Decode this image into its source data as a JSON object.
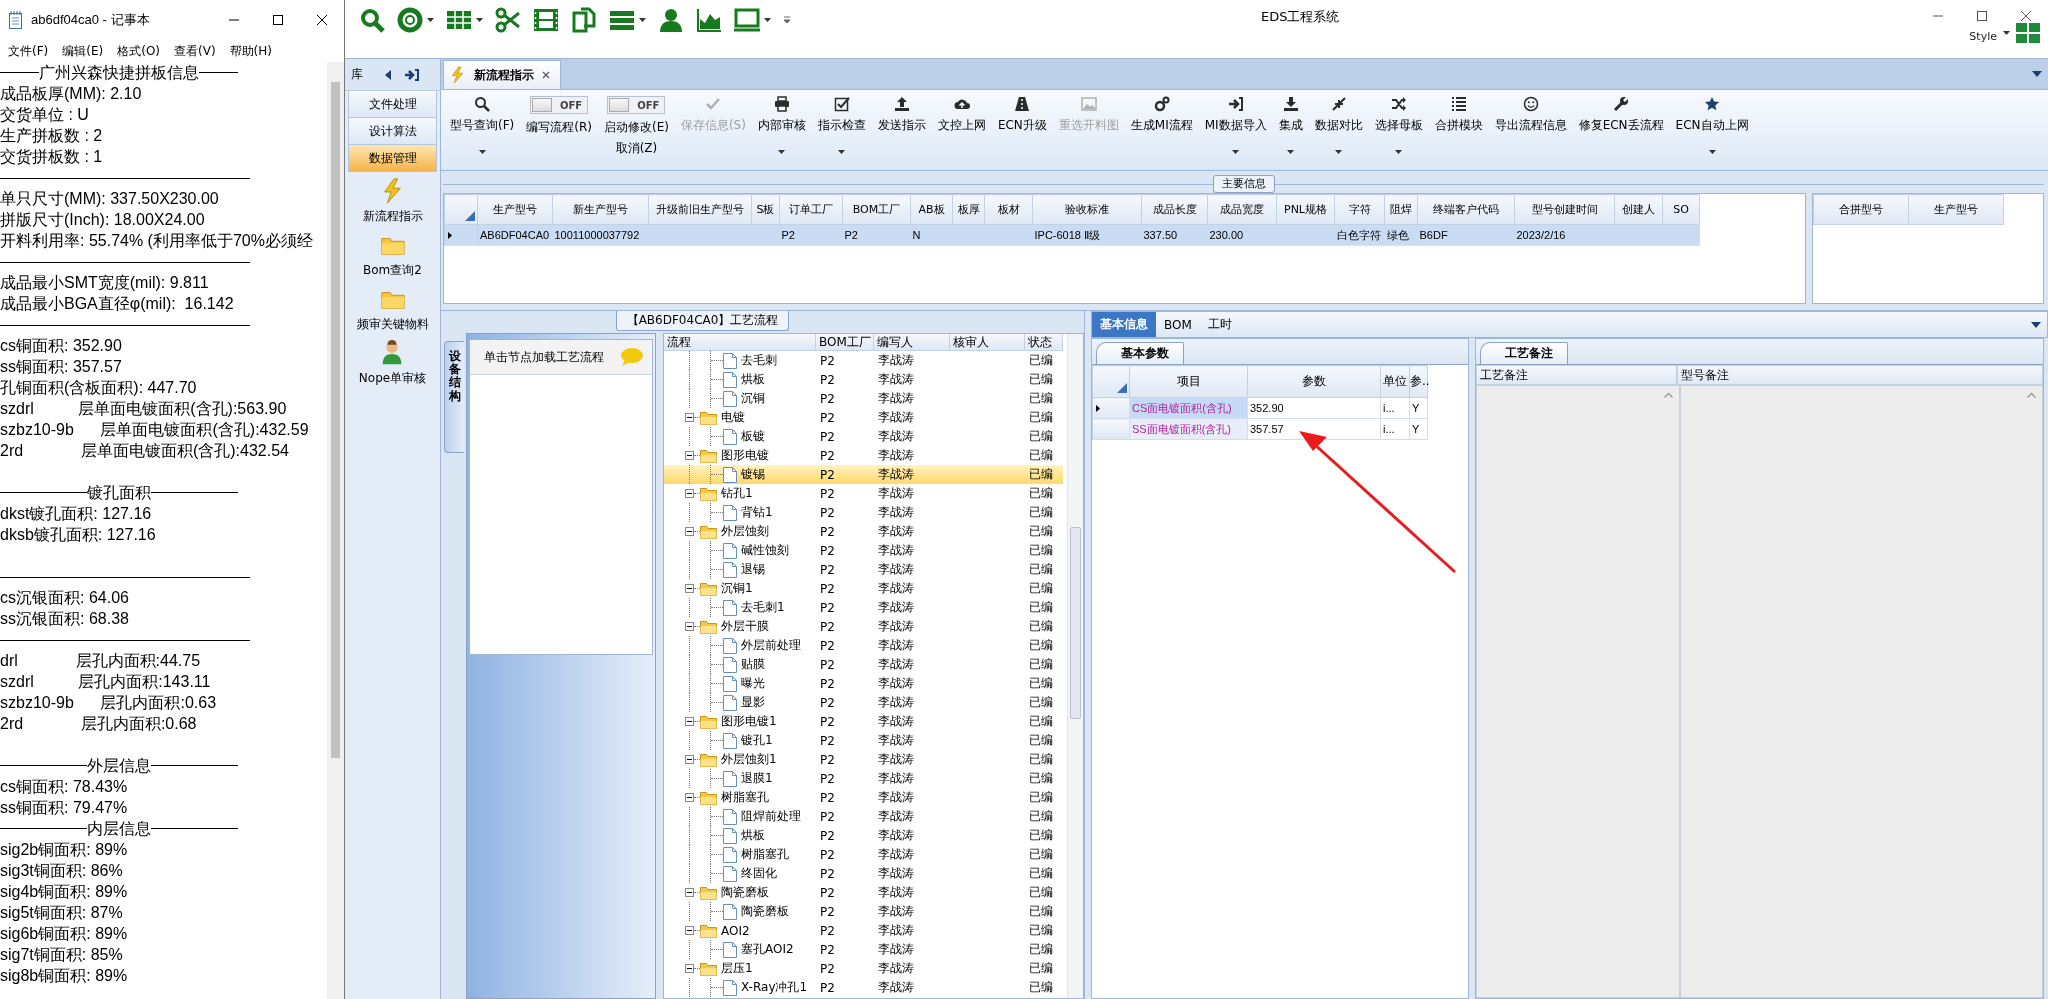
{
  "notepad": {
    "title": "ab6df04ca0 - 记事本",
    "menu": [
      "文件(F)",
      "编辑(E)",
      "格式(O)",
      "查看(V)",
      "帮助(H)"
    ],
    "lines": [
      {
        "kind": "heading",
        "text": "广州兴森快捷拼板信息"
      },
      {
        "kind": "text",
        "text": "成品板厚(MM): 2.10"
      },
      {
        "kind": "text",
        "text": "交货单位 : U"
      },
      {
        "kind": "text",
        "text": "生产拼板数 : 2"
      },
      {
        "kind": "text",
        "text": "交货拼板数 : 1"
      },
      {
        "kind": "rule"
      },
      {
        "kind": "text",
        "text": "单只尺寸(MM): 337.50X230.00"
      },
      {
        "kind": "text",
        "text": "拼版尺寸(Inch): 18.00X24.00"
      },
      {
        "kind": "text",
        "text": "开料利用率: 55.74% (利用率低于70%必须经"
      },
      {
        "kind": "rule"
      },
      {
        "kind": "text",
        "text": "成品最小SMT宽度(mil): 9.811"
      },
      {
        "kind": "text",
        "text": "成品最小BGA直径φ(mil):  16.142"
      },
      {
        "kind": "rule"
      },
      {
        "kind": "text",
        "text": "cs铜面积: 352.90"
      },
      {
        "kind": "text",
        "text": "ss铜面积: 357.57"
      },
      {
        "kind": "text",
        "text": "孔铜面积(含板面积): 447.70"
      },
      {
        "kind": "text",
        "text": "szdrl          层单面电镀面积(含孔):563.90"
      },
      {
        "kind": "text",
        "text": "szbz10-9b      层单面电镀面积(含孔):432.59"
      },
      {
        "kind": "text",
        "text": "2rd             层单面电镀面积(含孔):432.54"
      },
      {
        "kind": "blank"
      },
      {
        "kind": "heading",
        "text": "镀孔面积"
      },
      {
        "kind": "text",
        "text": "dkst镀孔面积: 127.16"
      },
      {
        "kind": "text",
        "text": "dksb镀孔面积: 127.16"
      },
      {
        "kind": "blank"
      },
      {
        "kind": "rule"
      },
      {
        "kind": "text",
        "text": "cs沉银面积: 64.06"
      },
      {
        "kind": "text",
        "text": "ss沉银面积: 68.38"
      },
      {
        "kind": "rule"
      },
      {
        "kind": "text",
        "text": "drl             层孔内面积:44.75"
      },
      {
        "kind": "text",
        "text": "szdrl          层孔内面积:143.11"
      },
      {
        "kind": "text",
        "text": "szbz10-9b      层孔内面积:0.63"
      },
      {
        "kind": "text",
        "text": "2rd             层孔内面积:0.68"
      },
      {
        "kind": "blank"
      },
      {
        "kind": "heading",
        "text": "外层信息"
      },
      {
        "kind": "text",
        "text": "cs铜面积: 78.43%"
      },
      {
        "kind": "text",
        "text": "ss铜面积: 79.47%"
      },
      {
        "kind": "heading",
        "text": "内层信息"
      },
      {
        "kind": "text",
        "text": "sig2b铜面积: 89%"
      },
      {
        "kind": "text",
        "text": "sig3t铜面积: 86%"
      },
      {
        "kind": "text",
        "text": "sig4b铜面积: 89%"
      },
      {
        "kind": "text",
        "text": "sig5t铜面积: 87%"
      },
      {
        "kind": "text",
        "text": "sig6b铜面积: 89%"
      },
      {
        "kind": "text",
        "text": "sig7t铜面积: 85%"
      },
      {
        "kind": "text",
        "text": "sig8b铜面积: 89%"
      }
    ]
  },
  "app": {
    "title": "EDS工程系统",
    "style_menu": "Style",
    "sidebar": {
      "header": "库",
      "items": [
        {
          "label": "文件处理",
          "selected": false
        },
        {
          "label": "设计算法",
          "selected": false
        },
        {
          "label": "数据管理",
          "selected": true
        }
      ],
      "shortcuts": [
        {
          "label": "新流程指示"
        },
        {
          "label": "Bom查询2"
        },
        {
          "label": "频审关键物料"
        },
        {
          "label": "Nope单审核"
        }
      ]
    },
    "tabs": [
      {
        "label": "新流程指示",
        "selected": true
      }
    ],
    "ribbon": [
      {
        "kind": "button",
        "label": "型号查询(F)",
        "disabled": false,
        "menu": true
      },
      {
        "kind": "toggle",
        "label": "编写流程(R)",
        "state_text": "OFF",
        "on": false
      },
      {
        "kind": "toggle",
        "label": "启动修改(E)",
        "label2": "取消(Z)",
        "state_text": "OFF",
        "on": false
      },
      {
        "kind": "button",
        "label": "保存信息(S)",
        "disabled": true,
        "menu": false
      },
      {
        "kind": "button",
        "label": "内部审核",
        "disabled": false,
        "menu": true
      },
      {
        "kind": "button",
        "label": "指示检查",
        "disabled": false,
        "menu": true
      },
      {
        "kind": "button",
        "label": "发送指示",
        "disabled": false,
        "menu": false
      },
      {
        "kind": "button",
        "label": "文控上网",
        "disabled": false,
        "menu": false
      },
      {
        "kind": "button",
        "label": "ECN升级",
        "disabled": false,
        "menu": false
      },
      {
        "kind": "button",
        "label": "重选开料图",
        "disabled": true,
        "menu": false
      },
      {
        "kind": "button",
        "label": "生成MI流程",
        "disabled": false,
        "menu": false
      },
      {
        "kind": "button",
        "label": "MI数据导入",
        "disabled": false,
        "menu": true
      },
      {
        "kind": "button",
        "label": "集成",
        "disabled": false,
        "menu": true
      },
      {
        "kind": "button",
        "label": "数据对比",
        "disabled": false,
        "menu": true
      },
      {
        "kind": "button",
        "label": "选择母板",
        "disabled": false,
        "menu": true
      },
      {
        "kind": "button",
        "label": "合拼模块",
        "disabled": false,
        "menu": false
      },
      {
        "kind": "button",
        "label": "导出流程信息",
        "disabled": false,
        "menu": false
      },
      {
        "kind": "button",
        "label": "修复ECN丢流程",
        "disabled": false,
        "menu": false
      },
      {
        "kind": "button",
        "label": "ECN自动上网",
        "disabled": false,
        "menu": true
      }
    ],
    "main_info": {
      "title": "主要信息",
      "columns": [
        "生产型号",
        "新生产型号",
        "升级前旧生产型号",
        "S板",
        "订单工厂",
        "BOM工厂",
        "AB板",
        "板厚",
        "板材",
        "验收标准",
        "成品长度",
        "成品宽度",
        "PNL规格",
        "字符",
        "阻焊",
        "终端客户代码",
        "型号创建时间",
        "创建人",
        "SO"
      ],
      "rows": [
        {
          "selected": true,
          "cells": [
            "AB6DF04CA0",
            "10011000037792",
            null,
            null,
            "P2",
            "P2",
            "N",
            null,
            null,
            "IPC-6018 Ⅱ级",
            "337.50",
            "230.00",
            null,
            "白色字符",
            "绿色",
            "B6DF",
            "2023/2/16",
            null,
            null
          ]
        }
      ],
      "side_columns": [
        "合拼型号",
        "生产型号"
      ]
    },
    "process_flow": {
      "title": "【AB6DF04CA0】工艺流程",
      "side_tab": "设备结构",
      "hint": "单击节点加载工艺流程",
      "columns": [
        "流程",
        "BOM工厂",
        "编写人",
        "核审人",
        "状态"
      ],
      "tree": [
        {
          "children": [
            {
              "label": "去毛刺",
              "factory": "P2",
              "author": "李战涛",
              "status": "已编",
              "selected": false
            },
            {
              "label": "烘板",
              "factory": "P2",
              "author": "李战涛",
              "status": "已编",
              "selected": false
            },
            {
              "label": "沉铜",
              "factory": "P2",
              "author": "李战涛",
              "status": "已编",
              "selected": false
            }
          ]
        },
        {
          "label": "电镀",
          "factory": "P2",
          "author": "李战涛",
          "status": "已编",
          "selected": false,
          "expanded": true,
          "children": [
            {
              "label": "板镀",
              "factory": "P2",
              "author": "李战涛",
              "status": "已编",
              "selected": false
            }
          ]
        },
        {
          "label": "图形电镀",
          "factory": "P2",
          "author": "李战涛",
          "status": "已编",
          "selected": false,
          "expanded": true,
          "children": [
            {
              "label": "镀锡",
              "factory": "P2",
              "author": "李战涛",
              "status": "已编",
              "selected": true
            }
          ]
        },
        {
          "label": "钻孔1",
          "factory": "P2",
          "author": "李战涛",
          "status": "已编",
          "selected": false,
          "expanded": true,
          "children": [
            {
              "label": "背钻1",
              "factory": "P2",
              "author": "李战涛",
              "status": "已编",
              "selected": false
            }
          ]
        },
        {
          "label": "外层蚀刻",
          "factory": "P2",
          "author": "李战涛",
          "status": "已编",
          "selected": false,
          "expanded": true,
          "children": [
            {
              "label": "碱性蚀刻",
              "factory": "P2",
              "author": "李战涛",
              "status": "已编",
              "selected": false
            },
            {
              "label": "退锡",
              "factory": "P2",
              "author": "李战涛",
              "status": "已编",
              "selected": false
            }
          ]
        },
        {
          "label": "沉铜1",
          "factory": "P2",
          "author": "李战涛",
          "status": "已编",
          "selected": false,
          "expanded": true,
          "children": [
            {
              "label": "去毛刺1",
              "factory": "P2",
              "author": "李战涛",
              "status": "已编",
              "selected": false
            }
          ]
        },
        {
          "label": "外层干膜",
          "factory": "P2",
          "author": "李战涛",
          "status": "已编",
          "selected": false,
          "expanded": true,
          "children": [
            {
              "label": "外层前处理",
              "factory": "P2",
              "author": "李战涛",
              "status": "已编",
              "selected": false
            },
            {
              "label": "贴膜",
              "factory": "P2",
              "author": "李战涛",
              "status": "已编",
              "selected": false
            },
            {
              "label": "曝光",
              "factory": "P2",
              "author": "李战涛",
              "status": "已编",
              "selected": false
            },
            {
              "label": "显影",
              "factory": "P2",
              "author": "李战涛",
              "status": "已编",
              "selected": false
            }
          ]
        },
        {
          "label": "图形电镀1",
          "factory": "P2",
          "author": "李战涛",
          "status": "已编",
          "selected": false,
          "expanded": true,
          "children": [
            {
              "label": "镀孔1",
              "factory": "P2",
              "author": "李战涛",
              "status": "已编",
              "selected": false
            }
          ]
        },
        {
          "label": "外层蚀刻1",
          "factory": "P2",
          "author": "李战涛",
          "status": "已编",
          "selected": false,
          "expanded": true,
          "children": [
            {
              "label": "退膜1",
              "factory": "P2",
              "author": "李战涛",
              "status": "已编",
              "selected": false
            }
          ]
        },
        {
          "label": "树脂塞孔",
          "factory": "P2",
          "author": "李战涛",
          "status": "已编",
          "selected": false,
          "expanded": true,
          "children": [
            {
              "label": "阻焊前处理",
              "factory": "P2",
              "author": "李战涛",
              "status": "已编",
              "selected": false
            },
            {
              "label": "烘板",
              "factory": "P2",
              "author": "李战涛",
              "status": "已编",
              "selected": false
            },
            {
              "label": "树脂塞孔",
              "factory": "P2",
              "author": "李战涛",
              "status": "已编",
              "selected": false
            },
            {
              "label": "终固化",
              "factory": "P2",
              "author": "李战涛",
              "status": "已编",
              "selected": false
            }
          ]
        },
        {
          "label": "陶瓷磨板",
          "factory": "P2",
          "author": "李战涛",
          "status": "已编",
          "selected": false,
          "expanded": true,
          "children": [
            {
              "label": "陶瓷磨板",
              "factory": "P2",
              "author": "李战涛",
              "status": "已编",
              "selected": false
            }
          ]
        },
        {
          "label": "AOI2",
          "factory": "P2",
          "author": "李战涛",
          "status": "已编",
          "selected": false,
          "expanded": true,
          "children": [
            {
              "label": "塞孔AOI2",
              "factory": "P2",
              "author": "李战涛",
              "status": "已编",
              "selected": false
            }
          ]
        },
        {
          "label": "层压1",
          "factory": "P2",
          "author": "李战涛",
          "status": "已编",
          "selected": false,
          "expanded": true,
          "children": [
            {
              "label": "X-Ray冲孔1",
              "factory": "P2",
              "author": "李战涛",
              "status": "已编",
              "selected": false
            }
          ]
        }
      ]
    },
    "detail": {
      "tabs": [
        {
          "label": "基本信息",
          "selected": true
        },
        {
          "label": "BOM",
          "selected": false
        },
        {
          "label": "工时",
          "selected": false
        }
      ],
      "params": {
        "tab": "基本参数",
        "columns": [
          "项目",
          "参数",
          "单位",
          "参.."
        ],
        "rows": [
          {
            "current": true,
            "cells": [
              "CS面电镀面积(含孔)",
              "352.90",
              "i...",
              "Y"
            ]
          },
          {
            "current": false,
            "cells": [
              "SS面电镀面积(含孔)",
              "357.57",
              "i...",
              "Y"
            ]
          }
        ]
      },
      "notes": {
        "tab": "工艺备注",
        "columns": [
          "工艺备注",
          "型号备注"
        ]
      }
    }
  }
}
